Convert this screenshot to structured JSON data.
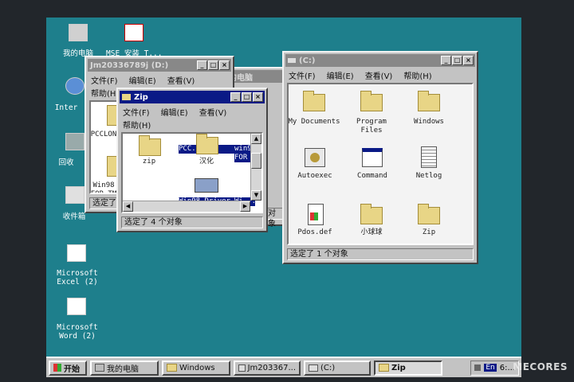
{
  "desktop": {
    "icons": [
      {
        "label": "我的电脑",
        "icon": "computer-icon"
      },
      {
        "label": "MSE 安装 T...",
        "icon": "msn-icon"
      },
      {
        "label": "Inter",
        "icon": "internet-explorer-icon"
      },
      {
        "label": "回收",
        "icon": "recycle-bin-icon"
      },
      {
        "label": "收件箱",
        "icon": "inbox-icon"
      },
      {
        "label": "Microsoft Excel (2)",
        "icon": "excel-shortcut-icon"
      },
      {
        "label": "Microsoft Word (2)",
        "icon": "word-shortcut-icon"
      }
    ]
  },
  "win_d": {
    "title": "Jm20336789j (D:)",
    "menu": [
      "文件(F)",
      "编辑(E)",
      "查看(V)"
    ],
    "menu2": [
      "帮助(H)"
    ],
    "items": [
      "PCCLON",
      "Win98 FOR_TM"
    ],
    "status": "选定了"
  },
  "win_mycomputer": {
    "title": "我的电脑",
    "status": "对象"
  },
  "win_zip": {
    "title": "Zip",
    "menu": [
      "文件(F)",
      "编辑(E)",
      "查看(V)"
    ],
    "menu2": [
      "帮助(H)"
    ],
    "items": [
      "zip",
      "PCC...",
      "汉化",
      "win98 FOR",
      "Win98 Driver...",
      "Wi..."
    ],
    "status": "选定了 4 个对象"
  },
  "win_c": {
    "title": "(C:)",
    "menu": [
      "文件(F)",
      "编辑(E)",
      "查看(V)",
      "帮助(H)"
    ],
    "items": [
      {
        "label": "My Documents",
        "icon": "folder-icon"
      },
      {
        "label": "Program Files",
        "icon": "folder-icon"
      },
      {
        "label": "Windows",
        "icon": "folder-icon"
      },
      {
        "label": "Autoexec",
        "icon": "autoexec-icon"
      },
      {
        "label": "Command",
        "icon": "command-icon"
      },
      {
        "label": "Netlog",
        "icon": "text-file-icon"
      },
      {
        "label": "Pdos.def",
        "icon": "file-icon"
      },
      {
        "label": "小球球",
        "icon": "folder-icon"
      },
      {
        "label": "Zip",
        "icon": "folder-icon"
      }
    ],
    "status": "选定了 1 个对象"
  },
  "taskbar": {
    "start": "开始",
    "buttons": [
      "我的电脑",
      "Windows",
      "Jm203367...",
      "(C:)",
      "Zip"
    ],
    "tray_lang": "En",
    "tray_time": "6:..."
  },
  "watermark": "MECORES"
}
